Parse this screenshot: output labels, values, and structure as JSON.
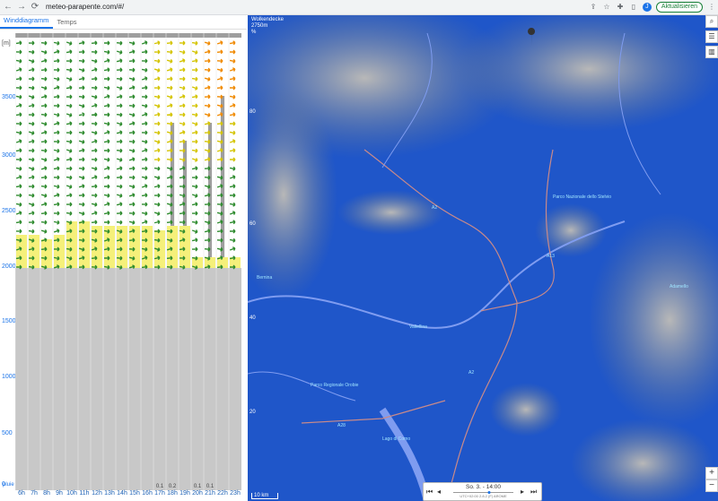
{
  "browser": {
    "url": "meteo-parapente.com/#/",
    "update_label": "Aktualisieren",
    "avatar_letter": "J"
  },
  "tabs": [
    {
      "label": "Winddiagramm",
      "active": true
    },
    {
      "label": "Temps",
      "active": false
    }
  ],
  "diagram": {
    "unit": "[m]",
    "y_ticks": [
      "3500",
      "3000",
      "2500",
      "2000",
      "1500",
      "1000",
      "500",
      "0"
    ],
    "hours": [
      "6h",
      "7h",
      "8h",
      "9h",
      "10h",
      "11h",
      "12h",
      "13h",
      "14h",
      "15h",
      "16h",
      "17h",
      "18h",
      "19h",
      "20h",
      "21h",
      "22h",
      "23h"
    ],
    "rain": [
      "",
      "",
      "",
      "",
      "",
      "",
      "",
      "",
      "",
      "",
      "",
      "0.1",
      "0.2",
      "",
      "0.1",
      "0.1",
      "",
      ""
    ],
    "rain_label": "pluie",
    "colors": {
      "terrain": "#c8c8c8",
      "thermal": "#f5f07a",
      "cloud": "#9e9e9e",
      "wind_low": "#2e8b2e",
      "wind_mid": "#d4c400",
      "wind_high": "#f08a00"
    }
  },
  "map": {
    "legend_title": "Wolkendecke",
    "legend_value": "2750m",
    "legend_pct": "%",
    "left_ticks": [
      "80",
      "60",
      "40",
      "20"
    ],
    "scale_label": "10 km",
    "player_time": "So. 3. - 14:00",
    "player_meta": "UTC+02:00   2.8.2 (F)   AROME",
    "places": [
      {
        "name": "Bernina",
        "x": 10,
        "y": 290
      },
      {
        "name": "Valtellina",
        "x": 180,
        "y": 345
      },
      {
        "name": "Parco Nazionale dello Stelvio",
        "x": 340,
        "y": 200
      },
      {
        "name": "Adamello",
        "x": 470,
        "y": 300
      },
      {
        "name": "Parco Regionale Orobie",
        "x": 70,
        "y": 410
      },
      {
        "name": "Lago di Como",
        "x": 150,
        "y": 470
      },
      {
        "name": "A2",
        "x": 205,
        "y": 212
      },
      {
        "name": "A13",
        "x": 333,
        "y": 266
      },
      {
        "name": "A2",
        "x": 246,
        "y": 396
      },
      {
        "name": "A28",
        "x": 100,
        "y": 455
      }
    ]
  }
}
